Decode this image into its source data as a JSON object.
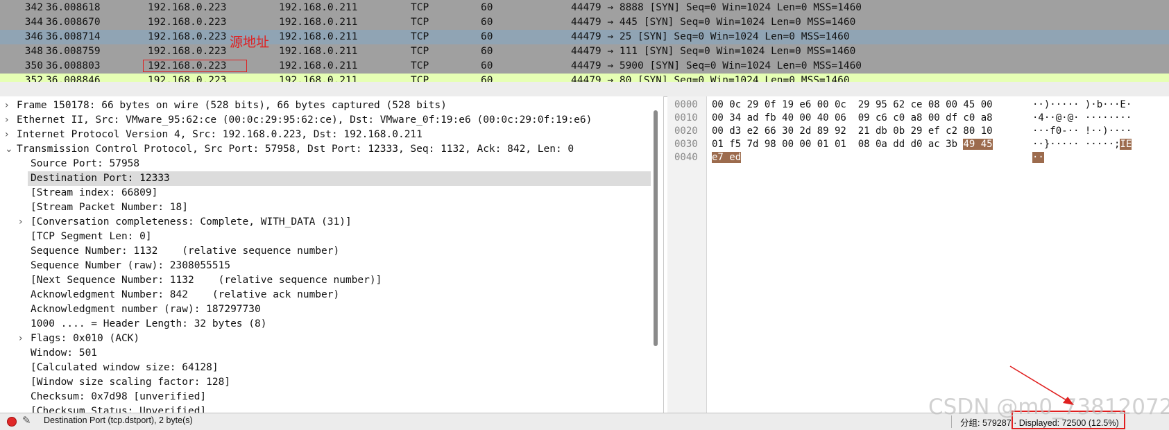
{
  "packet_list": {
    "rows": [
      {
        "no": "342",
        "time": "36.008618",
        "src": "192.168.0.223",
        "dst": "192.168.0.211",
        "proto": "TCP",
        "len": "60",
        "info": "44479 → 8888 [SYN] Seq=0 Win=1024 Len=0 MSS=1460"
      },
      {
        "no": "344",
        "time": "36.008670",
        "src": "192.168.0.223",
        "dst": "192.168.0.211",
        "proto": "TCP",
        "len": "60",
        "info": "44479 → 445 [SYN] Seq=0 Win=1024 Len=0 MSS=1460"
      },
      {
        "no": "346",
        "time": "36.008714",
        "src": "192.168.0.223",
        "dst": "192.168.0.211",
        "proto": "TCP",
        "len": "60",
        "info": "44479 → 25 [SYN] Seq=0 Win=1024 Len=0 MSS=1460"
      },
      {
        "no": "348",
        "time": "36.008759",
        "src": "192.168.0.223",
        "dst": "192.168.0.211",
        "proto": "TCP",
        "len": "60",
        "info": "44479 → 111 [SYN] Seq=0 Win=1024 Len=0 MSS=1460"
      },
      {
        "no": "350",
        "time": "36.008803",
        "src": "192.168.0.223",
        "dst": "192.168.0.211",
        "proto": "TCP",
        "len": "60",
        "info": "44479 → 5900 [SYN] Seq=0 Win=1024 Len=0 MSS=1460"
      },
      {
        "no": "352",
        "time": "36.008846",
        "src": "192.168.0.223",
        "dst": "192.168.0.211",
        "proto": "TCP",
        "len": "60",
        "info": "44479 → 80 [SYN] Seq=0 Win=1024 Len=0 MSS=1460"
      }
    ],
    "annotation_label": "源地址"
  },
  "details": {
    "rows": [
      {
        "arrow": "›",
        "text": "Frame 150178: 66 bytes on wire (528 bits), 66 bytes captured (528 bits)"
      },
      {
        "arrow": "›",
        "text": "Ethernet II, Src: VMware_95:62:ce (00:0c:29:95:62:ce), Dst: VMware_0f:19:e6 (00:0c:29:0f:19:e6)"
      },
      {
        "arrow": "›",
        "text": "Internet Protocol Version 4, Src: 192.168.0.223, Dst: 192.168.0.211"
      },
      {
        "arrow": "⌄",
        "text": "Transmission Control Protocol, Src Port: 57958, Dst Port: 12333, Seq: 1132, Ack: 842, Len: 0"
      },
      {
        "arrow": "",
        "text": "Source Port: 57958"
      },
      {
        "arrow": "",
        "text": "Destination Port: 12333"
      },
      {
        "arrow": "",
        "text": "[Stream index: 66809]"
      },
      {
        "arrow": "",
        "text": "[Stream Packet Number: 18]"
      },
      {
        "arrow": "›",
        "text": "[Conversation completeness: Complete, WITH_DATA (31)]"
      },
      {
        "arrow": "",
        "text": "[TCP Segment Len: 0]"
      },
      {
        "arrow": "",
        "text": "Sequence Number: 1132    (relative sequence number)"
      },
      {
        "arrow": "",
        "text": "Sequence Number (raw): 2308055515"
      },
      {
        "arrow": "",
        "text": "[Next Sequence Number: 1132    (relative sequence number)]"
      },
      {
        "arrow": "",
        "text": "Acknowledgment Number: 842    (relative ack number)"
      },
      {
        "arrow": "",
        "text": "Acknowledgment number (raw): 187297730"
      },
      {
        "arrow": "",
        "text": "1000 .... = Header Length: 32 bytes (8)"
      },
      {
        "arrow": "›",
        "text": "Flags: 0x010 (ACK)"
      },
      {
        "arrow": "",
        "text": "Window: 501"
      },
      {
        "arrow": "",
        "text": "[Calculated window size: 64128]"
      },
      {
        "arrow": "",
        "text": "[Window size scaling factor: 128]"
      },
      {
        "arrow": "",
        "text": "Checksum: 0x7d98 [unverified]"
      },
      {
        "arrow": "",
        "text": "[Checksum Status: Unverified]"
      }
    ]
  },
  "hex": {
    "rows": [
      {
        "offset": "0000",
        "bytes": "00 0c 29 0f 19 e6 00 0c  29 95 62 ce 08 00 45 00",
        "ascii": "··)····· )·b···E·"
      },
      {
        "offset": "0010",
        "bytes": "00 34 ad fb 40 00 40 06  09 c6 c0 a8 00 df c0 a8",
        "ascii": "·4··@·@· ········"
      },
      {
        "offset": "0020",
        "bytes": "00 d3 e2 66 30 2d 89 92  21 db 0b 29 ef c2 80 10",
        "ascii": "···f0-·· !··)····"
      },
      {
        "offset": "0030",
        "bytes_plain": "01 f5 7d 98 00 00 01 01  08 0a dd d0 ac 3b ",
        "bytes_hl": "49 45",
        "ascii_plain": "··}····· ·····;",
        "ascii_hl": "IE"
      },
      {
        "offset": "0040",
        "bytes_hl": "e7 ed",
        "ascii_hl": "··"
      }
    ]
  },
  "status": {
    "field_text": "Destination Port (tcp.dstport), 2 byte(s)",
    "stats_text": "分组: 579287 · Displayed: 72500 (12.5%)"
  },
  "watermark": "CSDN @m0_73812072"
}
